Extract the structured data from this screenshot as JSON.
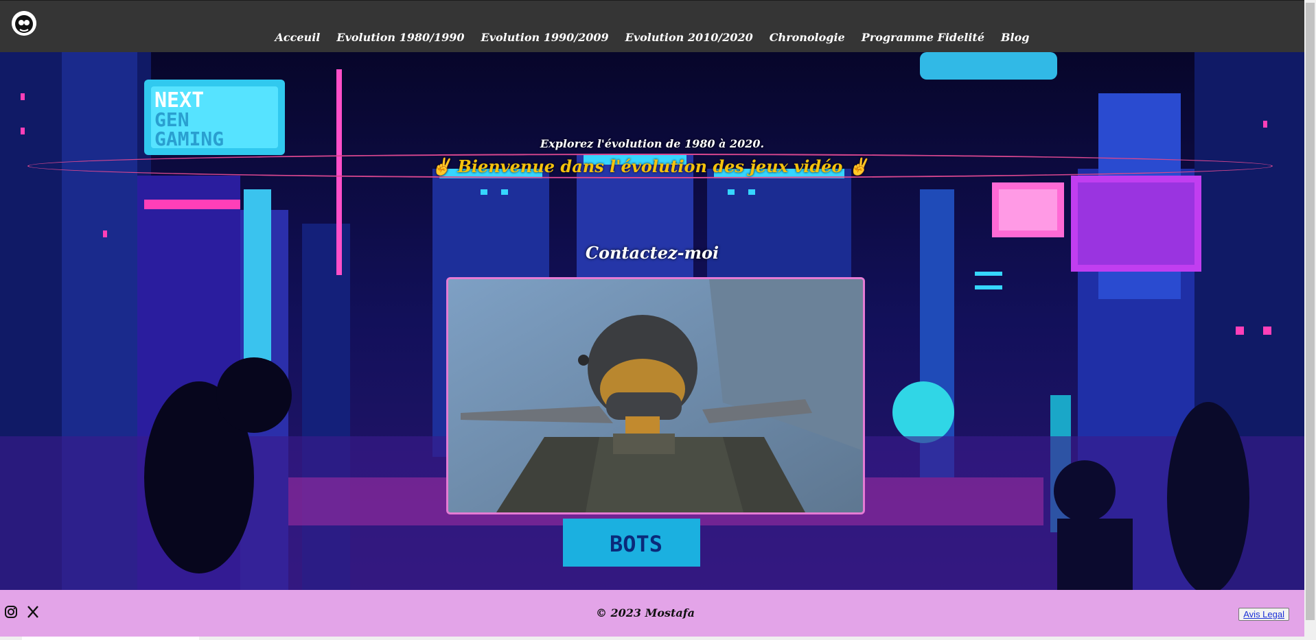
{
  "nav": {
    "items": [
      {
        "label": "Acceuil"
      },
      {
        "label": "Evolution 1980/1990"
      },
      {
        "label": "Evolution 1990/2009"
      },
      {
        "label": "Evolution 2010/2020"
      },
      {
        "label": "Chronologie"
      },
      {
        "label": "Programme Fidelité"
      },
      {
        "label": "Blog"
      }
    ]
  },
  "hero": {
    "banner_title": "✌️ Bienvenue dans l'évolution des jeux vidéo ✌️",
    "subtitle": "Explorez l'évolution de 1980 à 2020.",
    "contact_title": "Contactez-moi"
  },
  "footer": {
    "copyright": "© 2023 Mostafa",
    "legal_label": "Avis Legal",
    "social": [
      {
        "icon": "instagram-icon"
      },
      {
        "icon": "x-twitter-icon"
      }
    ]
  },
  "colors": {
    "header_bg": "#353535",
    "banner_text": "#f4c20d",
    "banner_border": "#d9478f",
    "video_border": "#e57bd4",
    "footer_bg": "#e3a4e8"
  }
}
